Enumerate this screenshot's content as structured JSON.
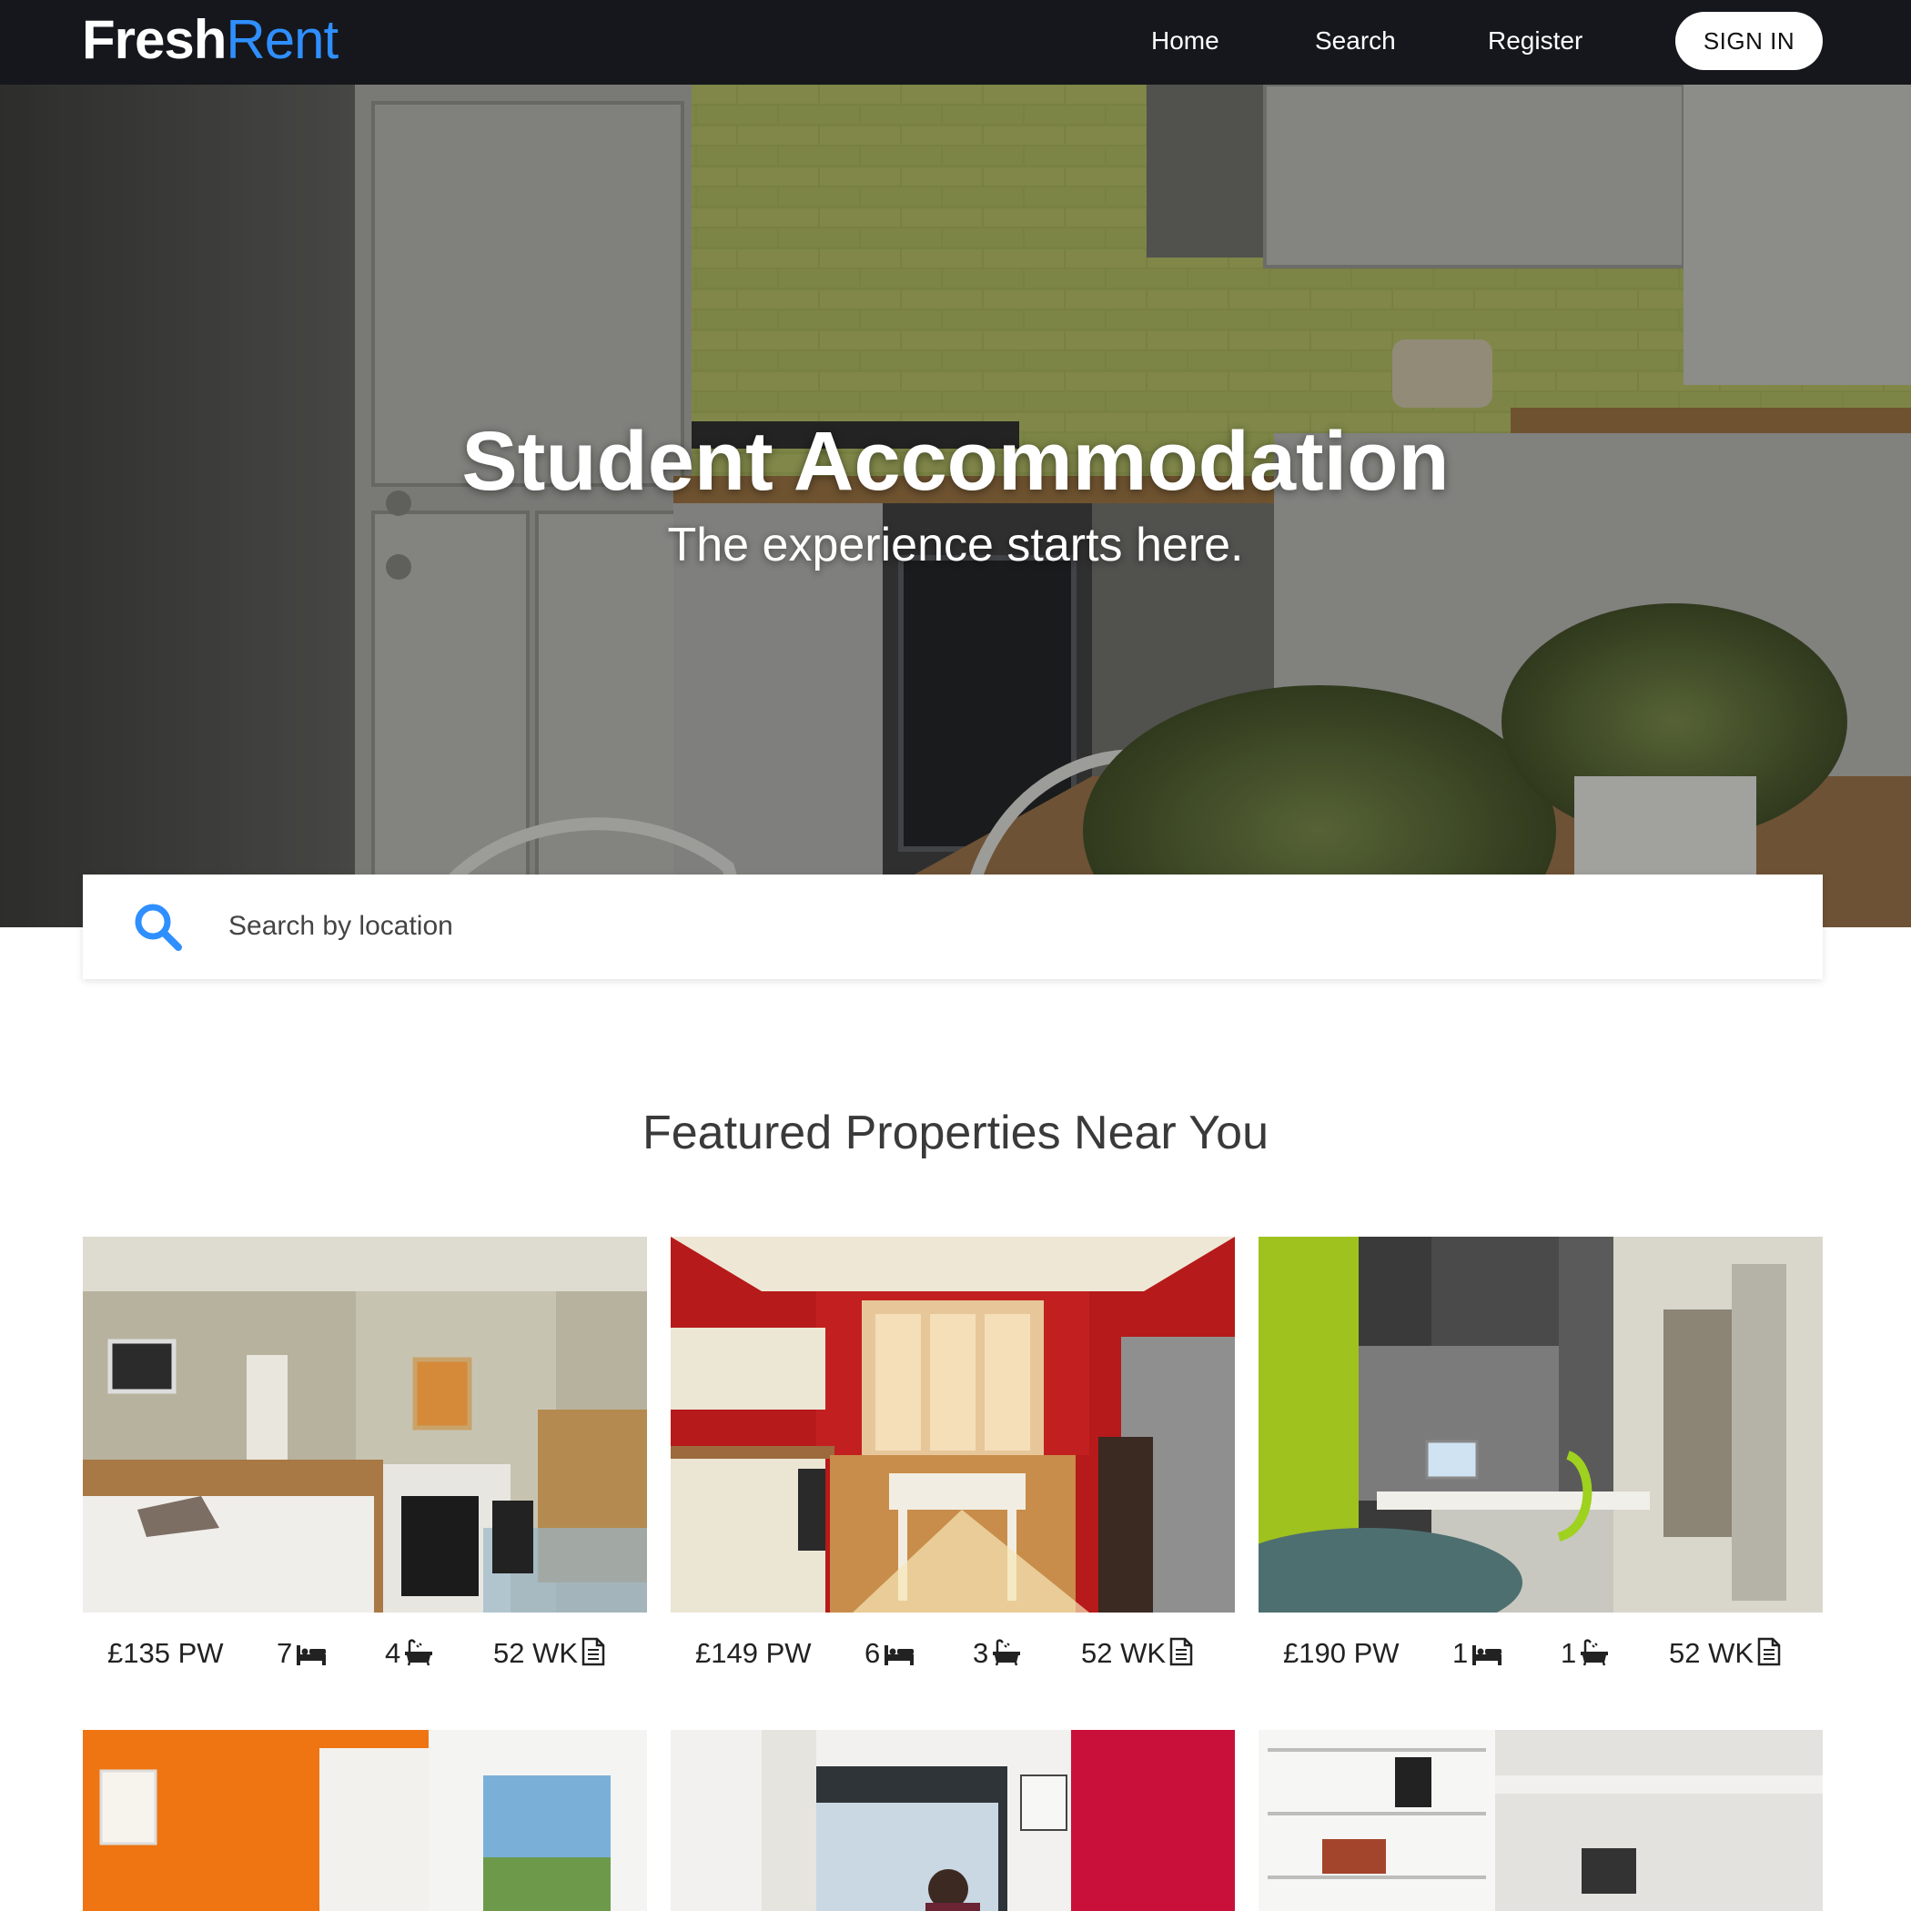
{
  "nav": {
    "logo_part1": "Fresh",
    "logo_part2": "Rent",
    "home": "Home",
    "search": "Search",
    "register": "Register",
    "signin": "SIGN IN"
  },
  "hero": {
    "title": "Student Accommodation",
    "subtitle": "The experience starts here."
  },
  "search": {
    "placeholder": "Search by location",
    "icon": "search-icon"
  },
  "featured": {
    "title": "Featured Properties Near You",
    "properties": [
      {
        "price": "£135 PW",
        "beds": "7",
        "baths": "4",
        "weeks": "52 WK"
      },
      {
        "price": "£149 PW",
        "beds": "6",
        "baths": "3",
        "weeks": "52 WK"
      },
      {
        "price": "£190 PW",
        "beds": "1",
        "baths": "1",
        "weeks": "52 WK"
      }
    ]
  },
  "colors": {
    "navbar": "#15171c",
    "accent": "#2f8fff",
    "search_icon": "#2f8fff"
  },
  "icons": [
    "bed-icon",
    "bath-icon",
    "document-icon",
    "search-icon"
  ]
}
